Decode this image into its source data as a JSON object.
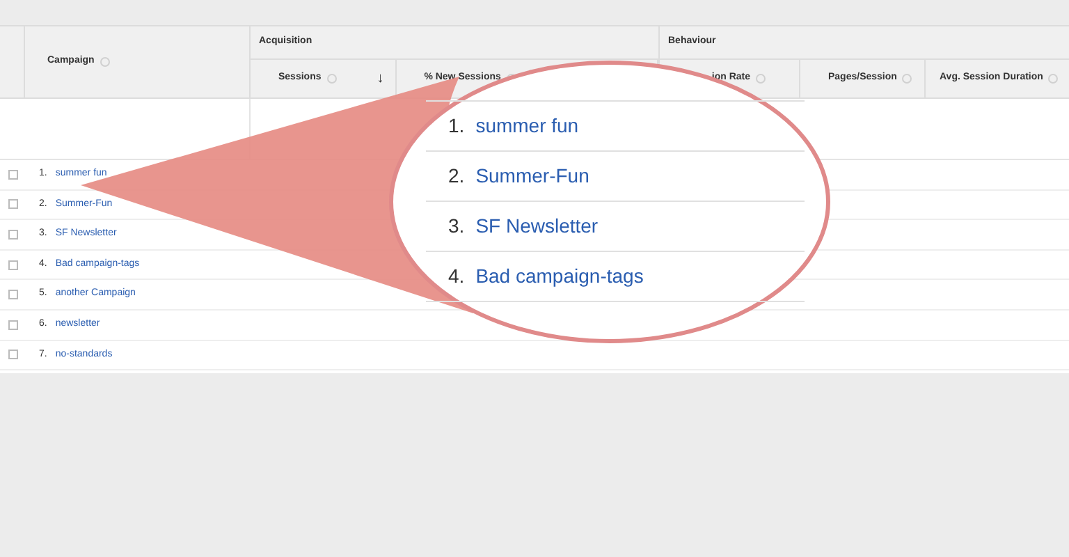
{
  "table": {
    "groups": [
      {
        "label": "Acquisition"
      },
      {
        "label": "Behaviour"
      }
    ],
    "columns": [
      {
        "label": "Campaign"
      },
      {
        "label": "Sessions",
        "sort_indicator": "↓"
      },
      {
        "label": "% New Sessions"
      },
      {
        "label": "ion Rate"
      },
      {
        "label": "Pages/Session"
      },
      {
        "label": "Avg. Session Duration"
      }
    ],
    "rows": [
      {
        "index": "1.",
        "campaign": "summer fun",
        "checked": false
      },
      {
        "index": "2.",
        "campaign": "Summer-Fun",
        "checked": false
      },
      {
        "index": "3.",
        "campaign": "SF Newsletter",
        "checked": false
      },
      {
        "index": "4.",
        "campaign": "Bad campaign-tags",
        "checked": false
      },
      {
        "index": "5.",
        "campaign": "another Campaign",
        "checked": false
      },
      {
        "index": "6.",
        "campaign": "newsletter",
        "checked": false
      },
      {
        "index": "7.",
        "campaign": "no-standards",
        "checked": false
      }
    ]
  },
  "magnifier": {
    "rows": [
      {
        "index": "1.",
        "campaign": "summer fun"
      },
      {
        "index": "2.",
        "campaign": "Summer-Fun"
      },
      {
        "index": "3.",
        "campaign": "SF Newsletter"
      },
      {
        "index": "4.",
        "campaign": "Bad campaign-tags"
      }
    ]
  }
}
